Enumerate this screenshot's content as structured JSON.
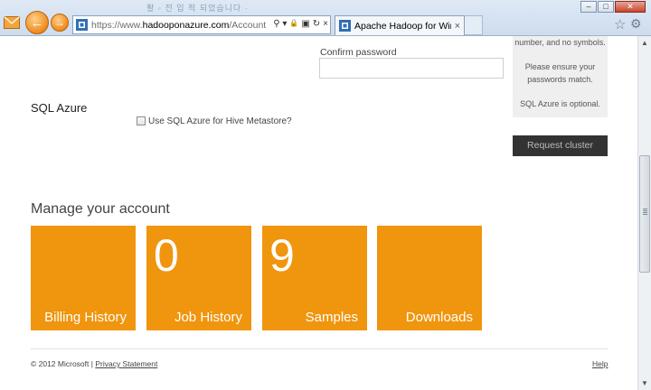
{
  "browser": {
    "title_ghost": "활 ◦ 전 입 적  되었습니다 ·",
    "address": {
      "prefix": "https://www.",
      "domain": "hadooponazure.com",
      "path": "/Account"
    },
    "tab_label": "Apache Hadoop for Windo...",
    "tab_close": "×",
    "back_glyph": "←",
    "forward_glyph": "→",
    "addr_icons": [
      "⚲ ▾",
      "🔒",
      "▣",
      "↻",
      "×"
    ],
    "window": {
      "minimize": "–",
      "maximize": "□",
      "close": "✕"
    },
    "accent_color": "#f08a1c"
  },
  "form": {
    "confirm_password_label": "Confirm password",
    "confirm_password_value": "",
    "sql_heading": "SQL Azure",
    "sql_checkbox_label": "Use SQL Azure for Hive Metastore?",
    "sql_checkbox_checked": false
  },
  "side_panel": {
    "line1": "number, and no symbols.",
    "line2": "Please ensure your",
    "line3": "passwords match.",
    "line4": "SQL Azure is optional.",
    "request_button": "Request cluster"
  },
  "account": {
    "heading": "Manage your account",
    "tile_color": "#f0950e",
    "tiles": [
      {
        "number": "",
        "label": "Billing History"
      },
      {
        "number": "0",
        "label": "Job History"
      },
      {
        "number": "9",
        "label": "Samples"
      },
      {
        "number": "",
        "label": "Downloads"
      }
    ]
  },
  "footer": {
    "copyright": "© 2012 Microsoft |",
    "privacy": "Privacy Statement",
    "help": "Help"
  }
}
